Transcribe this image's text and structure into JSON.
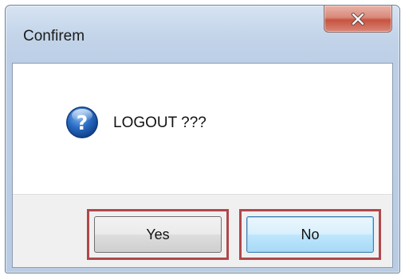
{
  "window": {
    "title": "Confirem"
  },
  "message": {
    "text": "LOGOUT ???",
    "icon": "question-icon"
  },
  "buttons": {
    "yes_label": "Yes",
    "no_label": "No",
    "default": "No"
  },
  "colors": {
    "close_button": "#c7533f",
    "highlight_border": "#b0474a",
    "default_button": "#bee6fd",
    "icon_blue": "#1f5fb4"
  }
}
